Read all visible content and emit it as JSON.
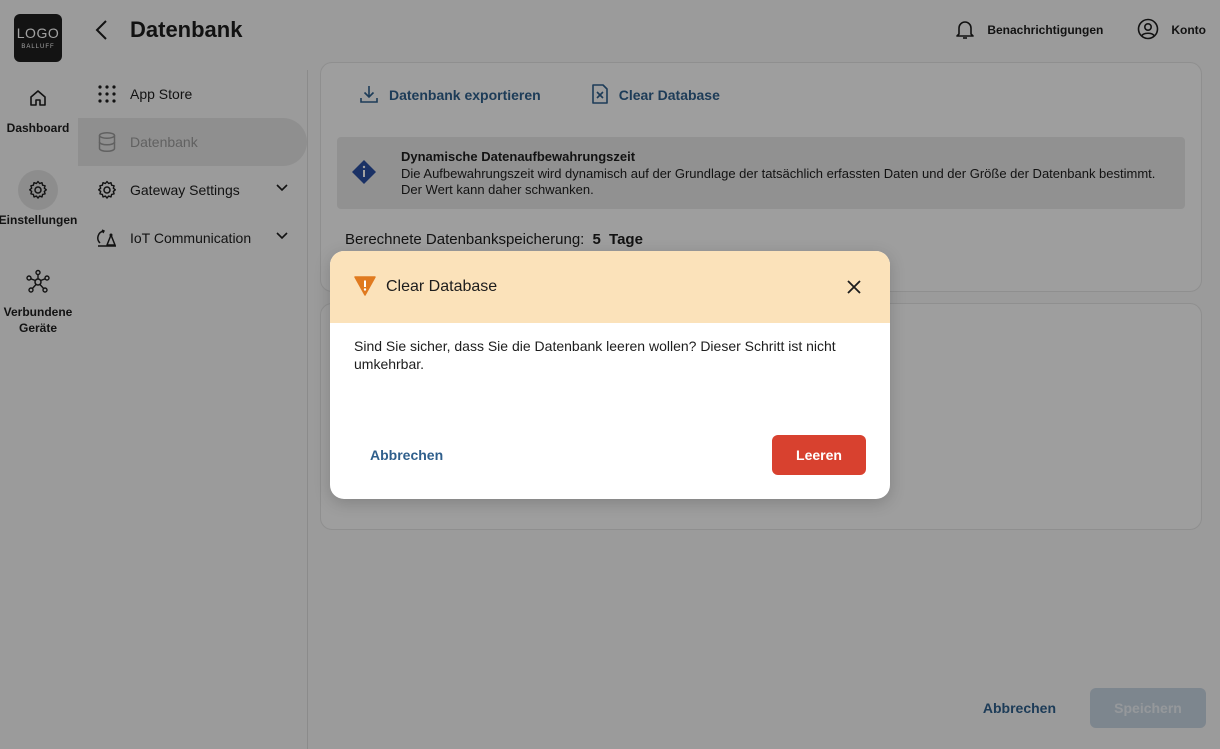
{
  "header": {
    "logo_text": "LOGO",
    "logo_subtext": "BALLUFF",
    "title": "Datenbank",
    "notifications_label": "Benachrichtigungen",
    "account_label": "Konto"
  },
  "rail": {
    "items": [
      {
        "label": "Dashboard",
        "icon": "home-icon",
        "active": false
      },
      {
        "label": "Einstellungen",
        "icon": "gear-icon",
        "active": true
      },
      {
        "label": "Verbundene Geräte",
        "icon": "network-icon",
        "active": false
      }
    ]
  },
  "subnav": {
    "items": [
      {
        "label": "App Store",
        "icon": "apps-grid-icon",
        "active": false
      },
      {
        "label": "Datenbank",
        "icon": "database-icon",
        "active": true
      },
      {
        "label": "Gateway Settings",
        "icon": "gear-icon",
        "active": false,
        "expandable": true
      },
      {
        "label": "IoT Communication",
        "icon": "iot-communication-icon",
        "active": false,
        "expandable": true
      }
    ]
  },
  "main": {
    "export_label": "Datenbank exportieren",
    "clear_label": "Clear Database",
    "info": {
      "title": "Dynamische Datenaufbewahrungszeit",
      "text": "Die Aufbewahrungszeit wird dynamisch auf der Grundlage der tatsächlich erfassten Daten und der Größe der Datenbank bestimmt. Der Wert kann daher schwanken."
    },
    "calc_label": "Berechnete Datenbankspeicherung:",
    "calc_value": "5",
    "calc_unit": "Tage"
  },
  "footer": {
    "cancel_label": "Abbrechen",
    "save_label": "Speichern"
  },
  "dialog": {
    "title": "Clear Database",
    "body": "Sind Sie sicher, dass Sie die Datenbank leeren wollen? Dieser Schritt ist nicht umkehrbar.",
    "cancel_label": "Abbrechen",
    "confirm_label": "Leeren"
  },
  "colors": {
    "accent": "#2f5f8c",
    "danger": "#d8412f",
    "warning_header": "#fbe2ba",
    "warning_icon": "#e07a1f",
    "info_icon": "#2a4fa0"
  }
}
